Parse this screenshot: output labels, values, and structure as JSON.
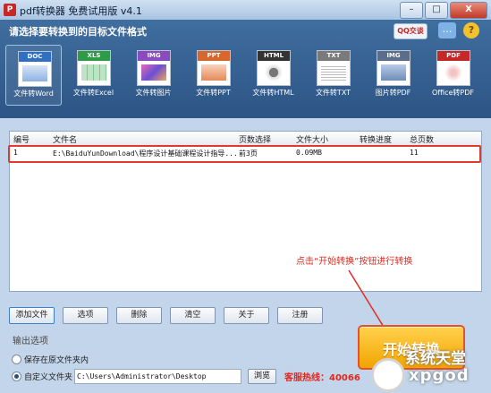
{
  "window": {
    "title": "pdf转换器 免费试用版 v4.1",
    "app_icon_text": "P",
    "controls": [
      "–",
      "□",
      "X"
    ]
  },
  "header": {
    "title": "请选择要转换到的目标文件格式",
    "qq_label": "QQ交谈",
    "help_label": "?",
    "msg_label": "…"
  },
  "tools": [
    {
      "tag": "DOC",
      "label": "文件转Word",
      "color": "#2f6fc4",
      "selected": true
    },
    {
      "tag": "XLS",
      "label": "文件转Excel",
      "color": "#2e9b46"
    },
    {
      "tag": "IMG",
      "label": "文件转图片",
      "color": "#8a4bbf"
    },
    {
      "tag": "PPT",
      "label": "文件转PPT",
      "color": "#d9672b"
    },
    {
      "tag": "HTML",
      "label": "文件转HTML",
      "color": "#333333"
    },
    {
      "tag": "TXT",
      "label": "文件转TXT",
      "color": "#7a7a7a"
    },
    {
      "tag": "IMG",
      "label": "图片转PDF",
      "color": "#5a6d8a"
    },
    {
      "tag": "PDF",
      "label": "Office转PDF",
      "color": "#c62828"
    }
  ],
  "table": {
    "columns": [
      "编号",
      "文件名",
      "页数选择",
      "文件大小",
      "转换进度",
      "总页数"
    ],
    "rows": [
      {
        "id": "1",
        "name": "E:\\BaiduYunDownload\\程序设计基础课程设计指导...",
        "pages": "前3页",
        "size": "0.09MB",
        "progress": "",
        "total": "11"
      }
    ]
  },
  "annotation": "点击“开始转换”按钮进行转换",
  "buttons": {
    "add": "添加文件",
    "options": "选项",
    "delete": "删除",
    "clear": "清空",
    "about": "关于",
    "register": "注册"
  },
  "output": {
    "title": "输出选项",
    "option_source": "保存在原文件夹内",
    "option_custom": "自定义文件夹",
    "path": "C:\\Users\\Administrator\\Desktop",
    "browse": "浏览",
    "selected": "custom"
  },
  "start_button": "开始转换",
  "hotline": "客服热线：40066",
  "watermark": {
    "cn": "系统天堂",
    "en": "xpgod"
  }
}
